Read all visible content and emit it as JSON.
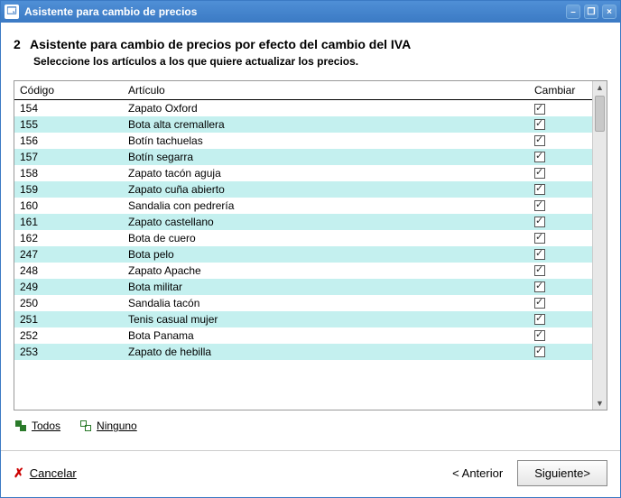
{
  "window": {
    "title": "Asistente para cambio de precios"
  },
  "step": {
    "number": "2",
    "title": "Asistente para cambio de precios por efecto del cambio del IVA",
    "subtitle": "Seleccione los artículos a los que quiere actualizar los precios."
  },
  "table": {
    "headers": {
      "code": "Código",
      "article": "Artículo",
      "change": "Cambiar"
    },
    "rows": [
      {
        "code": "154",
        "article": "Zapato Oxford",
        "checked": true
      },
      {
        "code": "155",
        "article": "Bota alta cremallera",
        "checked": true
      },
      {
        "code": "156",
        "article": "Botín tachuelas",
        "checked": true
      },
      {
        "code": "157",
        "article": "Botín segarra",
        "checked": true
      },
      {
        "code": "158",
        "article": "Zapato tacón aguja",
        "checked": true
      },
      {
        "code": "159",
        "article": "Zapato cuña abierto",
        "checked": true
      },
      {
        "code": "160",
        "article": "Sandalia con pedrería",
        "checked": true
      },
      {
        "code": "161",
        "article": "Zapato castellano",
        "checked": true
      },
      {
        "code": "162",
        "article": "Bota de cuero",
        "checked": true
      },
      {
        "code": "247",
        "article": "Bota pelo",
        "checked": true
      },
      {
        "code": "248",
        "article": "Zapato Apache",
        "checked": true
      },
      {
        "code": "249",
        "article": "Bota militar",
        "checked": true
      },
      {
        "code": "250",
        "article": "Sandalia tacón",
        "checked": true
      },
      {
        "code": "251",
        "article": "Tenis casual mujer",
        "checked": true
      },
      {
        "code": "252",
        "article": "Bota Panama",
        "checked": true
      },
      {
        "code": "253",
        "article": "Zapato de hebilla",
        "checked": true
      }
    ]
  },
  "selection": {
    "all": "Todos",
    "none": "Ninguno"
  },
  "footer": {
    "cancel": "Cancelar",
    "previous": "< Anterior",
    "next": "Siguiente>"
  }
}
